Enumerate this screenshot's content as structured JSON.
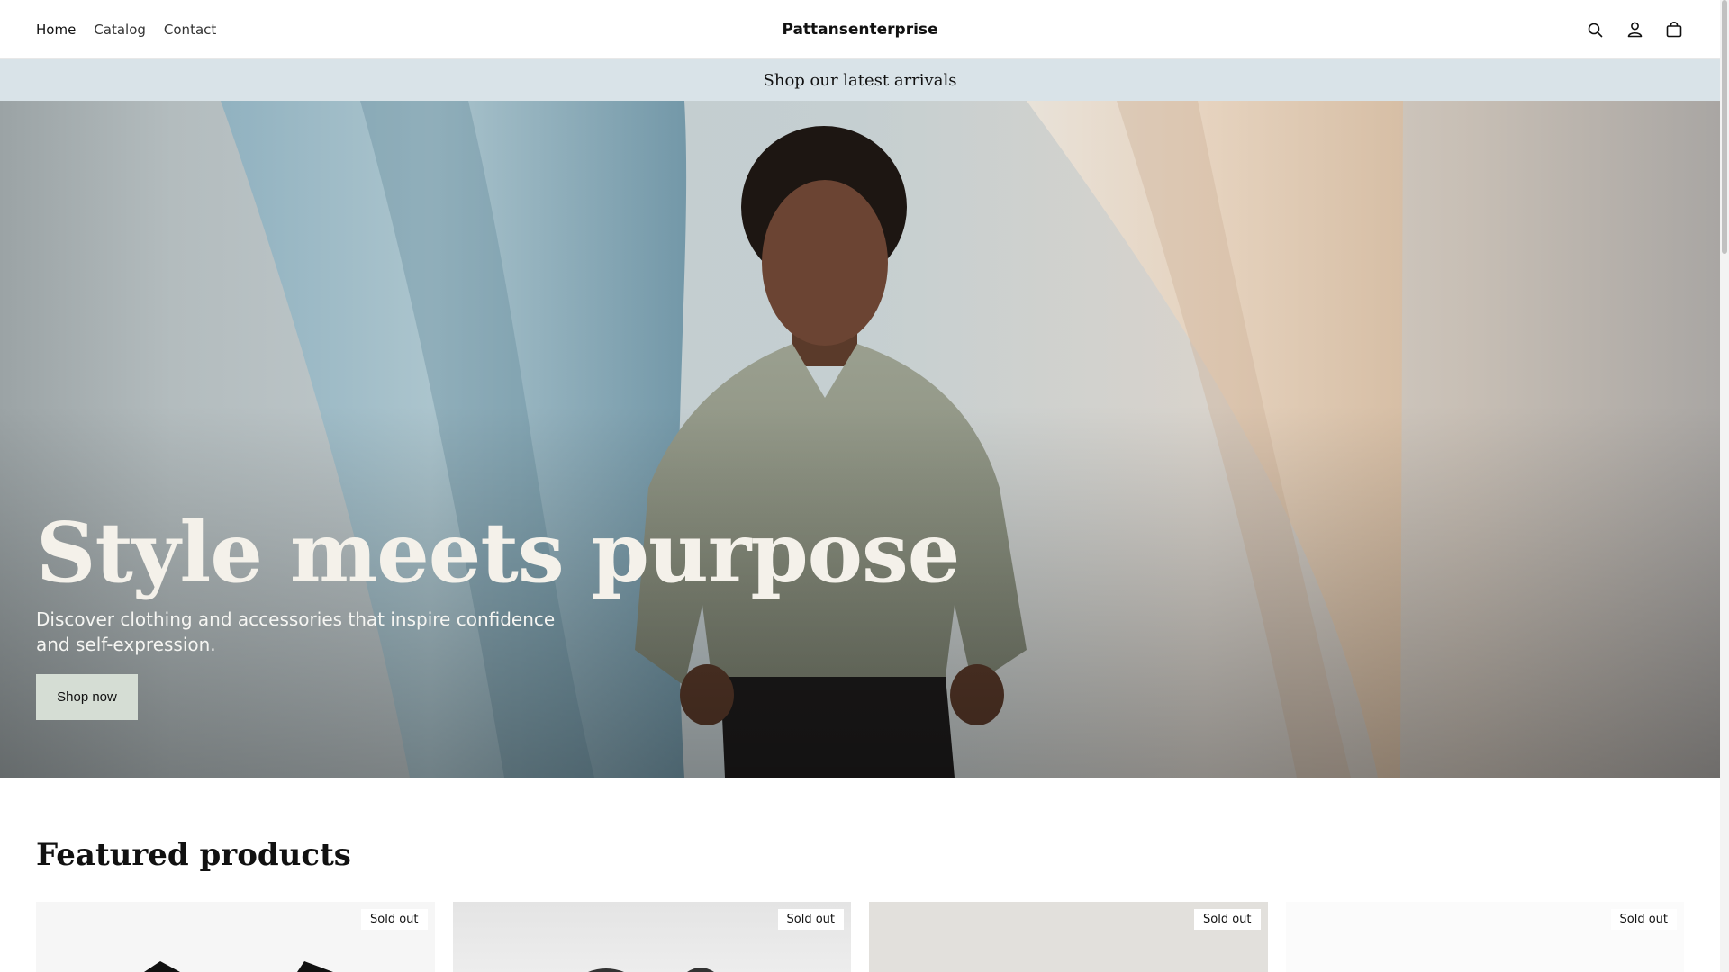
{
  "header": {
    "nav": [
      {
        "label": "Home"
      },
      {
        "label": "Catalog"
      },
      {
        "label": "Contact"
      }
    ],
    "brand": "Pattansenterprise",
    "icons": [
      "search-icon",
      "account-icon",
      "cart-icon"
    ]
  },
  "announcement": {
    "text": "Shop our latest arrivals"
  },
  "hero": {
    "title": "Style meets purpose",
    "subtitle": "Discover clothing and accessories that inspire confidence and self-expression.",
    "cta_label": "Shop now"
  },
  "featured": {
    "title": "Featured products",
    "products": [
      {
        "badge": "Sold out"
      },
      {
        "badge": "Sold out"
      },
      {
        "badge": "Sold out"
      },
      {
        "badge": "Sold out"
      }
    ]
  },
  "colors": {
    "announcement_bg": "#d9e3e8",
    "cta_bg": "#d5ddd4"
  }
}
